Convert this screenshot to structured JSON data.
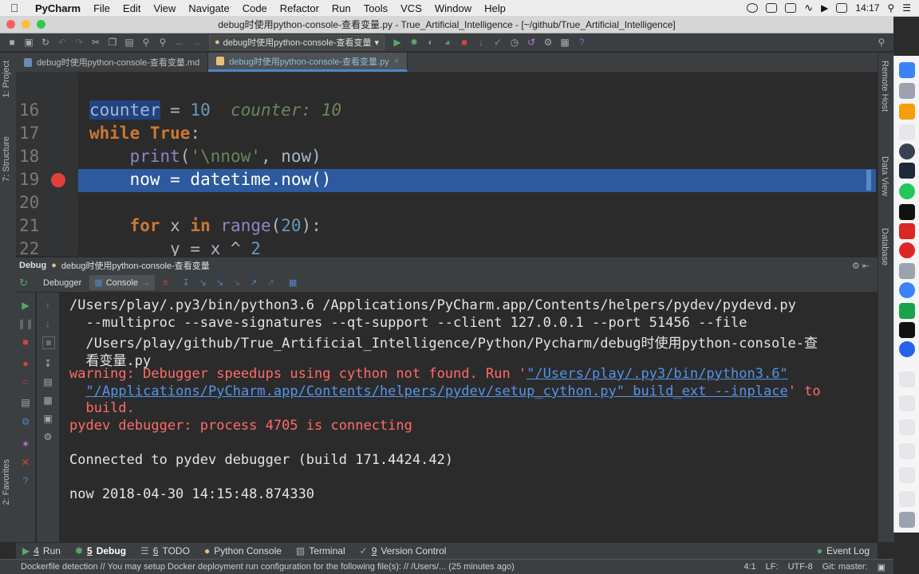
{
  "menubar": {
    "app": "PyCharm",
    "items": [
      "File",
      "Edit",
      "View",
      "Navigate",
      "Code",
      "Refactor",
      "Run",
      "Tools",
      "VCS",
      "Window",
      "Help"
    ],
    "clock": "14:17"
  },
  "window_title": "debug时使用python-console-查看变量.py - True_Artificial_Intelligence - [~/github/True_Artificial_Intelligence]",
  "toolbar": {
    "run_config": "debug时使用python-console-查看变量"
  },
  "tabs": [
    {
      "label": "debug时使用python-console-查看变量.md"
    },
    {
      "label": "debug时使用python-console-查看变量.py"
    }
  ],
  "left_strip": {
    "project": "1: Project",
    "structure": "7: Structure",
    "favorites": "2: Favorites"
  },
  "right_strip": {
    "remote": "Remote Host",
    "dataview": "Data View",
    "database": "Database"
  },
  "editor": {
    "line_numbers": [
      "16",
      "17",
      "18",
      "19",
      "20",
      "21",
      "22"
    ],
    "inline_value": "counter: 10"
  },
  "debug_panel": {
    "title": "Debug",
    "config": "debug时使用python-console-查看变量",
    "tab_debugger": "Debugger",
    "tab_console": "Console"
  },
  "console": {
    "line1": "/Users/play/.py3/bin/python3.6 /Applications/PyCharm.app/Contents/helpers/pydev/pydevd.py",
    "line2": "  --multiproc --save-signatures --qt-support --client 127.0.0.1 --port 51456 --file",
    "line3": "  /Users/play/github/True_Artificial_Intelligence/Python/Pycharm/debug时使用python-console-查",
    "line4": "  看变量.py",
    "warn_prefix": "warning: Debugger speedups using cython not found. Run '",
    "warn_link1": "\"/Users/play/.py3/bin/python3.6\"",
    "warn_link2": "\"/Applications/PyCharm.app/Contents/helpers/pydev/setup_cython.py\" build_ext --inplace",
    "warn_suffix": "' to",
    "warn_end": "  build.",
    "connecting": "pydev debugger: process 4705 is connecting",
    "connected": "Connected to pydev debugger (build 171.4424.42)",
    "now": "now 2018-04-30 14:15:48.874330"
  },
  "toolwindows": [
    {
      "num": "4",
      "label": "Run"
    },
    {
      "num": "5",
      "label": "Debug"
    },
    {
      "num": "6",
      "label": "TODO"
    },
    {
      "num": "",
      "label": "Python Console"
    },
    {
      "num": "",
      "label": "Terminal"
    },
    {
      "num": "9",
      "label": "Version Control"
    }
  ],
  "event_log": "Event Log",
  "status": {
    "message": "Dockerfile detection  // You may setup Docker deployment run configuration for the following file(s): // /Users/... (25 minutes ago)",
    "position": "4:1",
    "line_sep": "LF:",
    "encoding": "UTF-8",
    "git": "Git: master:"
  }
}
